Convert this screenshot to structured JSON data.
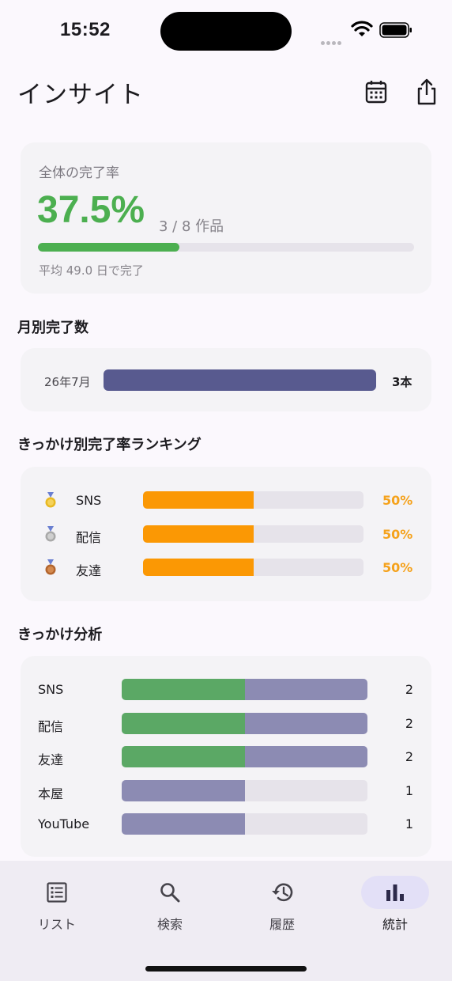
{
  "status_bar": {
    "time": "15:52"
  },
  "header": {
    "title": "インサイト",
    "calendar_icon": "calendar-icon",
    "share_icon": "share-icon"
  },
  "overall": {
    "label": "全体の完了率",
    "percent": "37.5%",
    "count": "3 / 8 作品",
    "progress_fraction": 0.375,
    "average": "平均 49.0 日で完了",
    "accent_color": "#4caf50"
  },
  "monthly": {
    "title": "月別完了数",
    "rows": [
      {
        "label": "26年7月",
        "value": "3本",
        "fraction": 1.0
      }
    ],
    "bar_color": "#585a8f"
  },
  "ranking": {
    "title": "きっかけ別完了率ランキング",
    "rows": [
      {
        "medal": "gold-medal-icon",
        "name": "SNS",
        "percent": "50%",
        "fraction": 0.5
      },
      {
        "medal": "silver-medal-icon",
        "name": "配信",
        "percent": "50%",
        "fraction": 0.5
      },
      {
        "medal": "bronze-medal-icon",
        "name": "友達",
        "percent": "50%",
        "fraction": 0.5
      }
    ],
    "bar_color": "#fb9804"
  },
  "analysis": {
    "title": "きっかけ分析",
    "rows": [
      {
        "name": "SNS",
        "value": "2",
        "completed": 1,
        "total": 2
      },
      {
        "name": "配信",
        "value": "2",
        "completed": 1,
        "total": 2
      },
      {
        "name": "友達",
        "value": "2",
        "completed": 1,
        "total": 2
      },
      {
        "name": "本屋",
        "value": "1",
        "completed": 0,
        "total": 1
      },
      {
        "name": "YouTube",
        "value": "1",
        "completed": 0,
        "total": 1
      }
    ],
    "max_total": 2,
    "completed_color": "#5ba865",
    "remaining_color": "#8c8bb3"
  },
  "nav": {
    "items": [
      {
        "label": "リスト",
        "icon": "list-icon",
        "active": false
      },
      {
        "label": "検索",
        "icon": "search-icon",
        "active": false
      },
      {
        "label": "履歴",
        "icon": "history-icon",
        "active": false
      },
      {
        "label": "統計",
        "icon": "bar-chart-icon",
        "active": true
      }
    ]
  }
}
